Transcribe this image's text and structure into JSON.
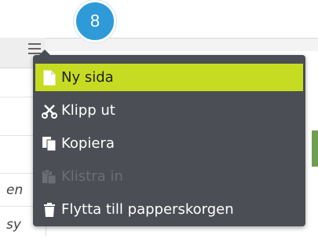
{
  "badge": {
    "number": "8"
  },
  "background": {
    "row_fragments": [
      "en",
      "sy"
    ]
  },
  "menu": {
    "items": [
      {
        "label": "Ny sida",
        "icon": "new-page-icon",
        "state": "active"
      },
      {
        "label": "Klipp ut",
        "icon": "scissors-icon",
        "state": "normal"
      },
      {
        "label": "Kopiera",
        "icon": "copy-icon",
        "state": "normal"
      },
      {
        "label": "Klistra in",
        "icon": "paste-icon",
        "state": "disabled"
      },
      {
        "label": "Flytta till papperskorgen",
        "icon": "trash-icon",
        "state": "normal"
      }
    ]
  },
  "colors": {
    "menu_bg": "#4b4e54",
    "highlight": "#c6dc22",
    "badge": "#2e9bd8",
    "disabled_text": "#6b6e74"
  }
}
